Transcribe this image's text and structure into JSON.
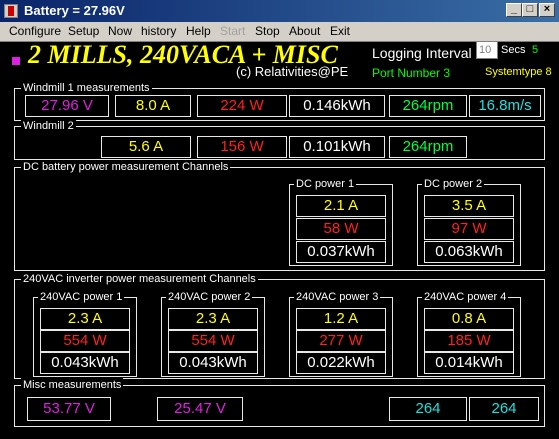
{
  "window": {
    "title": "Battery = 27.96V",
    "controls": {
      "minimize": "_",
      "maximize": "□",
      "close": "×"
    }
  },
  "menu": [
    "Configure",
    "Setup",
    "Now",
    "history",
    "Help",
    "Start",
    "Stop",
    "About",
    "Exit"
  ],
  "header": {
    "app_title": "2 MILLS, 240VACA + MISC",
    "credit": "(c) Relativities@PE",
    "logging_label": "Logging Interval",
    "interval_value": "10",
    "secs_label": "Secs",
    "secs_value": "5",
    "port_label": "Port Number 3",
    "systemtype": "Systemtype 8"
  },
  "windmill1": {
    "label": "Windmill 1 measurements",
    "voltage": "27.96 V",
    "current": "8.0 A",
    "power": "224 W",
    "energy": "0.146kWh",
    "rpm": "264rpm",
    "wind": "16.8m/s"
  },
  "windmill2": {
    "label": "Windmill 2",
    "current": "5.6 A",
    "power": "156 W",
    "energy": "0.101kWh",
    "rpm": "264rpm"
  },
  "dc": {
    "label": "DC battery power measurement Channels",
    "channels": [
      {
        "label": "DC power 1",
        "current": "2.1 A",
        "power": "58 W",
        "energy": "0.037kWh"
      },
      {
        "label": "DC power 2",
        "current": "3.5 A",
        "power": "97 W",
        "energy": "0.063kWh"
      }
    ]
  },
  "ac": {
    "label": "240VAC inverter power measurement Channels",
    "channels": [
      {
        "label": "240VAC power 1",
        "current": "2.3 A",
        "power": "554 W",
        "energy": "0.043kWh"
      },
      {
        "label": "240VAC power 2",
        "current": "2.3 A",
        "power": "554 W",
        "energy": "0.043kWh"
      },
      {
        "label": "240VAC power 3",
        "current": "1.2 A",
        "power": "277 W",
        "energy": "0.022kWh"
      },
      {
        "label": "240VAC power 4",
        "current": "0.8 A",
        "power": "185 W",
        "energy": "0.014kWh"
      }
    ]
  },
  "misc": {
    "label": "Misc measurements",
    "v1": "53.77 V",
    "v2": "25.47 V",
    "n1": "264",
    "n2": "264"
  },
  "colors": {
    "title_bar": "#0a246a",
    "menu_bar": "#d4d0c8",
    "voltage": "#e020e0",
    "current": "#ffff00",
    "power": "#ff2020",
    "energy": "#ffffff",
    "rpm": "#00ff40",
    "wind": "#20e0e0",
    "background": "#000000"
  }
}
